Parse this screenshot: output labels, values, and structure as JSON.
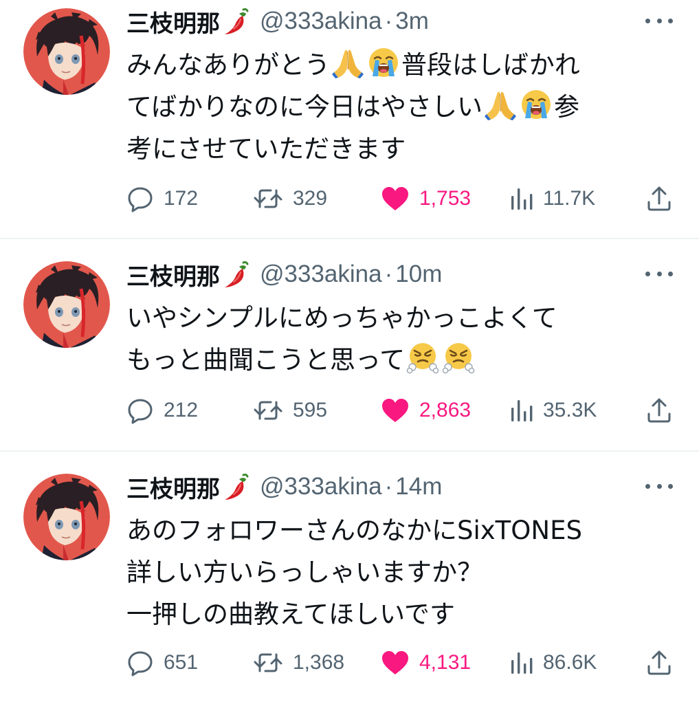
{
  "tweets": [
    {
      "display_name": "三枝明那",
      "handle": "@333akina",
      "separator": "·",
      "time": "3m",
      "text_lines": [
        [
          "みんなありがとう",
          "folded-hands-emoji",
          "loudly-crying-emoji",
          "普段はしばかれ"
        ],
        [
          "てばかりなのに今日はやさしい",
          "folded-hands-emoji",
          "loudly-crying-emoji",
          "参"
        ],
        [
          "考にさせていただきます"
        ]
      ],
      "replies": "172",
      "retweets": "329",
      "likes": "1,753",
      "views": "11.7K"
    },
    {
      "display_name": "三枝明那",
      "handle": "@333akina",
      "separator": "·",
      "time": "10m",
      "text_lines": [
        [
          "いやシンプルにめっちゃかっこよくて"
        ],
        [
          "もっと曲聞こうと思って",
          "steam-nose-emoji",
          "steam-nose-emoji"
        ]
      ],
      "replies": "212",
      "retweets": "595",
      "likes": "2,863",
      "views": "35.3K"
    },
    {
      "display_name": "三枝明那",
      "handle": "@333akina",
      "separator": "·",
      "time": "14m",
      "text_lines": [
        [
          "あのフォロワーさんのなかにSixTONES"
        ],
        [
          "詳しい方いらっしゃいますか？"
        ],
        [
          "一押しの曲教えてほしいです"
        ]
      ],
      "replies": "651",
      "retweets": "1,368",
      "likes": "4,131",
      "views": "86.6K"
    }
  ],
  "icons": {
    "name_emoji": "chili-pepper-icon",
    "reply": "reply-icon",
    "retweet": "retweet-icon",
    "like": "heart-icon",
    "views": "views-icon",
    "share": "share-icon",
    "more": "more-icon"
  },
  "colors": {
    "text": "#0f1419",
    "secondary": "#536471",
    "like": "#f91880",
    "avatar_bg": "#e2574c",
    "divider": "#eff3f4"
  }
}
